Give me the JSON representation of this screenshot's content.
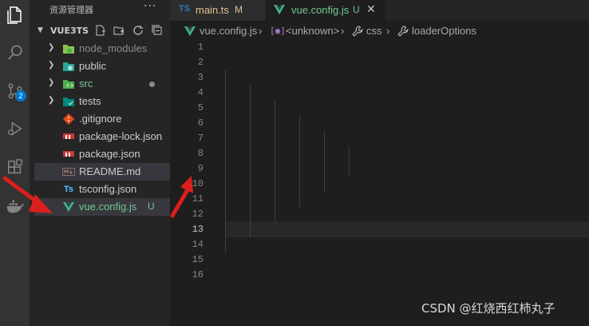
{
  "activity_bar": {
    "icons": [
      "explorer-icon",
      "search-icon",
      "source-control-icon",
      "run-debug-icon",
      "extensions-icon",
      "docker-icon"
    ],
    "scm_badge": "2"
  },
  "sidebar": {
    "title": "资源管理器",
    "more": "···",
    "project": "VUE3TS",
    "items": [
      {
        "label": "node_modules",
        "type": "folder",
        "color": "#8c8c8c",
        "icon": "folder-node-icon"
      },
      {
        "label": "public",
        "type": "folder",
        "color": "#cccccc",
        "icon": "folder-public-icon"
      },
      {
        "label": "src",
        "type": "folder",
        "color": "#73c991",
        "icon": "folder-src-icon"
      },
      {
        "label": "tests",
        "type": "folder",
        "color": "#cccccc",
        "icon": "folder-tests-icon"
      },
      {
        "label": ".gitignore",
        "type": "file",
        "color": "#cccccc",
        "icon": "git-icon"
      },
      {
        "label": "package-lock.json",
        "type": "file",
        "color": "#cccccc",
        "icon": "npm-icon"
      },
      {
        "label": "package.json",
        "type": "file",
        "color": "#cccccc",
        "icon": "npm-icon"
      },
      {
        "label": "README.md",
        "type": "file",
        "color": "#cccccc",
        "icon": "markdown-icon"
      },
      {
        "label": "tsconfig.json",
        "type": "file",
        "color": "#cccccc",
        "icon": "ts-icon"
      },
      {
        "label": "vue.config.js",
        "type": "file",
        "color": "#73c991",
        "icon": "vue-icon",
        "badge": "U"
      }
    ]
  },
  "tabs": [
    {
      "icon": "TS",
      "label": "main.ts",
      "status": "M",
      "label_color": "#e2c08d"
    },
    {
      "icon": "V",
      "label": "vue.config.js",
      "status": "U",
      "label_color": "#73c991",
      "close": "✕"
    }
  ],
  "breadcrumb": [
    "vue.config.js",
    "<unknown>",
    "css",
    "loaderOptions"
  ],
  "editor": {
    "current_line": 13,
    "line_numbers": [
      "1",
      "2",
      "3",
      "4",
      "5",
      "6",
      "7",
      "8",
      "9",
      "10",
      "11",
      "12",
      "13",
      "14",
      "15",
      "16"
    ]
  },
  "watermark": "CSDN @红烧西红柿丸子",
  "colors": {
    "accent": "#007acc",
    "annotation_arrow": "#d9201c"
  }
}
